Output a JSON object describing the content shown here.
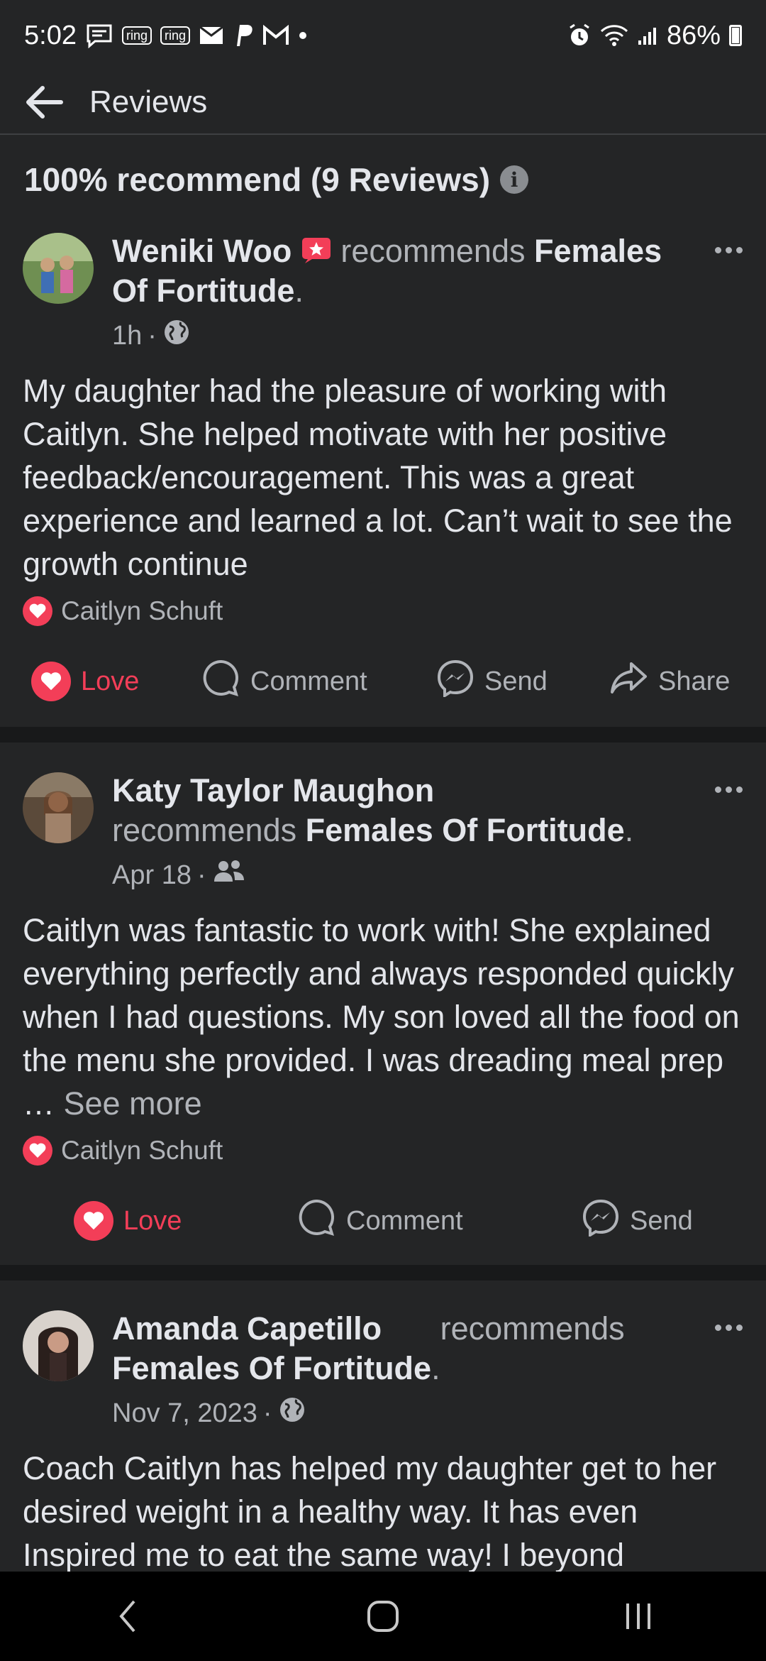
{
  "status_bar": {
    "time": "5:02",
    "ring1": "ring",
    "ring2": "ring",
    "battery": "86%"
  },
  "header": {
    "title": "Reviews"
  },
  "summary": {
    "text": "100% recommend (9 Reviews)"
  },
  "reviews": [
    {
      "author": "Weniki Woo",
      "verb": "recommends",
      "page": "Females Of Fortitude",
      "time": "1h",
      "audience_icon": "globe-icon",
      "text": "My daughter had the pleasure of working with Caitlyn. She helped motivate with her positive feedback/encouragement. This was a great experience and learned a lot. Can’t wait to see the growth continue",
      "reactor": "Caitlyn Schuft",
      "actions": {
        "love": "Love",
        "comment": "Comment",
        "send": "Send",
        "share": "Share"
      }
    },
    {
      "author": "Katy Taylor Maughon",
      "verb": "recommends",
      "page": "Females Of Fortitude",
      "time": "Apr 18",
      "audience_icon": "friends-icon",
      "text": "Caitlyn was fantastic to work with!  She explained everything perfectly and always responded quickly when I had questions. My son loved all the food on the menu she provided.  I was dreading meal prep …",
      "see_more": "See more",
      "reactor": "Caitlyn Schuft",
      "actions": {
        "love": "Love",
        "comment": "Comment",
        "send": "Send"
      }
    },
    {
      "author": "Amanda Capetillo",
      "verb": "recommends",
      "page": "Females Of Fortitude",
      "time": "Nov 7, 2023",
      "audience_icon": "globe-icon",
      "text": "Coach Caitlyn has helped my daughter get to her desired weight in a healthy way. It has even Inspired me to eat the same way! I beyond"
    }
  ],
  "colors": {
    "background": "#242526",
    "love": "#f33e58",
    "muted": "#b0b3b8",
    "divider": "#18191a"
  }
}
